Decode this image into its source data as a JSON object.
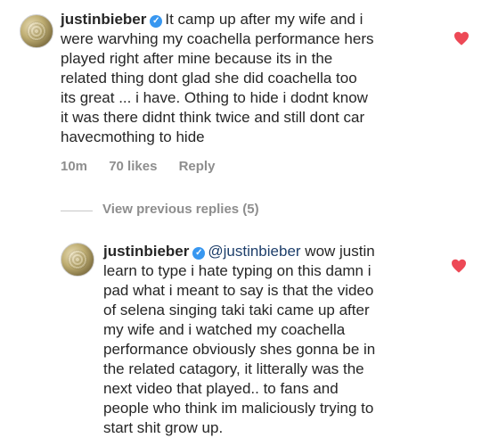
{
  "comment1": {
    "username": "justinbieber",
    "text": "It camp up after  my wife and i\nwere warvhing my coachella performance hers\nplayed right after mine because its in the\nrelated thing dont glad she did coachella too\nits great ...  i have. Othing to hide i dodnt know\nit was there didnt think twice and still dont car\nhavecmothing to hide",
    "time": "10m",
    "likes": "70 likes",
    "reply_label": "Reply",
    "liked": true
  },
  "view_previous": {
    "label": "View previous replies (5)"
  },
  "comment2": {
    "username": "justinbieber",
    "mention": "@justinbieber",
    "text_first": " wow justin",
    "text_rest": "learn to type i hate typing on this damn i\npad what i meant to say is that the video\nof selena singing taki taki came up after\nmy wife and i watched my coachella\nperformance obviously shes gonna be in\nthe related catagory, it litterally was the\nnext video that played.. to fans and\npeople who think im maliciously trying to\nstart shit grow up.",
    "liked": true
  },
  "icons": {
    "verified": "verified-badge-icon",
    "heart": "heart-icon",
    "avatar": "avatar-image"
  },
  "colors": {
    "heart": "#ed4956",
    "verified": "#3897f0",
    "meta_text": "#8e8e8e",
    "mention": "#1e3f6b"
  }
}
